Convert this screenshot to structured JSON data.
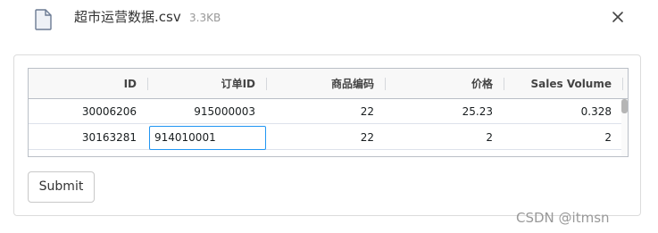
{
  "file": {
    "name": "超市运营数据.csv",
    "size": "3.3KB"
  },
  "grid": {
    "columns": [
      "ID",
      "订单ID",
      "商品编码",
      "价格",
      "Sales Volume"
    ],
    "rows": [
      [
        "30006206",
        "915000003",
        "22",
        "25.23",
        "0.328"
      ],
      [
        "30163281",
        "914010001",
        "22",
        "2",
        "2"
      ]
    ]
  },
  "actions": {
    "submit_label": "Submit"
  },
  "watermark": "CSDN @itmsn"
}
